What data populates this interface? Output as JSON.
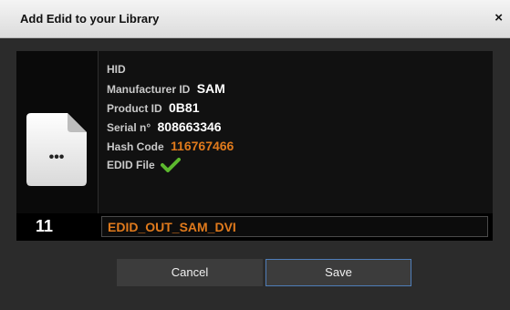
{
  "window": {
    "title": "Add  Edid to your Library",
    "close_label": "×"
  },
  "edid": {
    "type_label": "HID",
    "manufacturer_label": "Manufacturer ID",
    "manufacturer_value": "SAM",
    "product_label": "Product ID",
    "product_value": "0B81",
    "serial_label": "Serial n°",
    "serial_value": "808663346",
    "hash_label": "Hash Code",
    "hash_value": "116767466",
    "file_label": "EDID File",
    "file_icon_text": "•••"
  },
  "slot": {
    "index": "11",
    "name_value": "EDID_OUT_SAM_DVI"
  },
  "buttons": {
    "cancel_label": "Cancel",
    "save_label": "Save"
  },
  "colors": {
    "accent_orange": "#e07a1c",
    "check_green": "#5cb82e",
    "save_border": "#4f7db8"
  }
}
